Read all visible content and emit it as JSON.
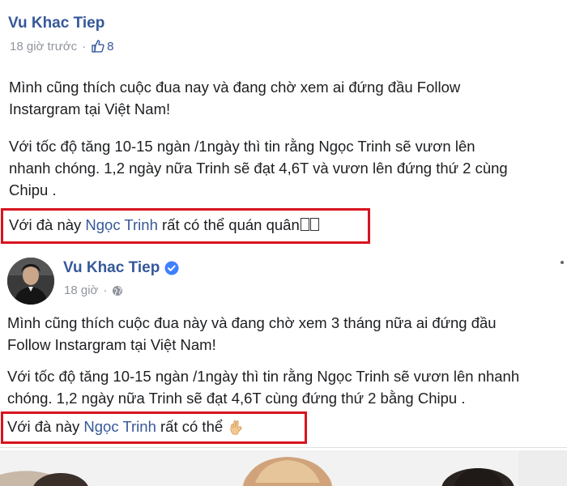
{
  "post1": {
    "author": "Vu Khac Tiep",
    "time": "18 giờ trước",
    "dot": "·",
    "likes": "8",
    "para1_line1": "Mình cũng thích cuộc đua nay và đang chờ xem ai đứng đầu Follow",
    "para1_line2": "Instargram tại Việt Nam!",
    "para2_line1": "Với tốc độ tăng 10-15 ngàn /1ngày thì tin rằng Ngọc Trinh sẽ vươn lên",
    "para2_line2": "nhanh chóng. 1,2 ngày nữa Trinh sẽ đạt 4,6T và vươn lên đứng thứ 2 cùng",
    "para2_line3": "Chipu .",
    "highlight_pre": "Với đà này ",
    "highlight_link": "Ngọc Trinh",
    "highlight_post": " rất có thể quán quân"
  },
  "post2": {
    "author": "Vu Khac Tiep",
    "time": "18 giờ",
    "dot": "·",
    "para1_line1": "Mình cũng thích cuộc đua này và đang chờ xem 3 tháng nữa ai đứng đầu",
    "para1_line2": "Follow Instargram tại Việt Nam!",
    "para2_line1": "Với tốc độ tăng 10-15 ngàn /1ngày thì tin rằng Ngọc Trinh sẽ vươn lên nhanh",
    "para2_line2": "chóng. 1,2 ngày nữa Trinh sẽ đạt 4,6T cùng đứng thứ 2 bằng Chipu .",
    "highlight_pre": "Với đà này ",
    "highlight_link": "Ngọc Trinh",
    "highlight_post": " rất có thể "
  },
  "colors": {
    "link": "#365899",
    "highlight_border": "#d7141f",
    "verified": "#4080ff",
    "meta": "#90949c"
  },
  "icons": {
    "like": "thumbs-up-icon",
    "globe": "globe-icon",
    "verified": "verified-badge-icon",
    "ok_hand": "ok-hand-emoji"
  }
}
